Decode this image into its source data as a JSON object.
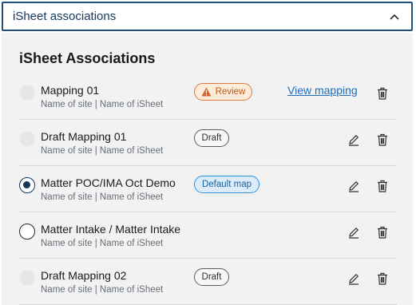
{
  "accordion": {
    "title": "iSheet associations",
    "expanded": true
  },
  "section": {
    "title": "iSheet Associations"
  },
  "colors": {
    "primary": "#12385e",
    "link": "#1a6fc2",
    "review": "#c05512",
    "default": "#17609e"
  },
  "rows": [
    {
      "name": "Mapping 01",
      "subtitle": "Name of site | Name of iSheet",
      "radio": "disabled",
      "badge": "Review",
      "badge_type": "review",
      "badge_icon": "warning-icon",
      "link": "View mapping",
      "actions": [
        "trash-icon"
      ]
    },
    {
      "name": "Draft Mapping 01",
      "subtitle": "Name of site | Name of iSheet",
      "radio": "disabled",
      "badge": "Draft",
      "badge_type": "draft",
      "actions": [
        "pencil-icon",
        "trash-icon"
      ]
    },
    {
      "name": "Matter POC/IMA Oct Demo",
      "subtitle": "Name of site | Name of iSheet",
      "radio": "checked",
      "badge": "Default map",
      "badge_type": "default",
      "actions": [
        "pencil-icon",
        "trash-icon"
      ]
    },
    {
      "name": "Matter Intake / Matter Intake",
      "subtitle": "Name of site | Name of iSheet",
      "radio": "empty",
      "actions": [
        "pencil-icon",
        "trash-icon"
      ]
    },
    {
      "name": "Draft Mapping 02",
      "subtitle": "Name of site | Name of iSheet",
      "radio": "disabled",
      "badge": "Draft",
      "badge_type": "draft",
      "actions": [
        "pencil-icon",
        "trash-icon"
      ]
    }
  ]
}
